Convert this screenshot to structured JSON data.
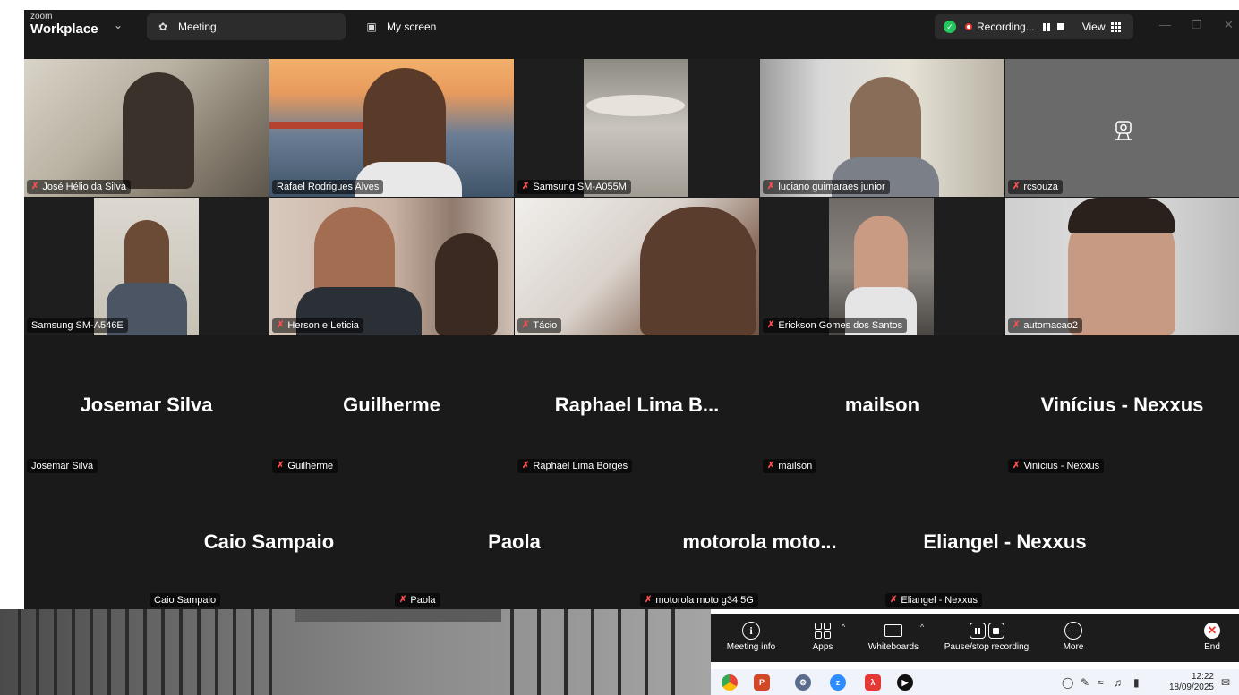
{
  "window": {
    "brand_top": "zoom",
    "brand_bottom": "Workplace",
    "tabs": [
      {
        "label": "Meeting"
      },
      {
        "label": "My screen"
      }
    ],
    "recording_label": "Recording...",
    "view_label": "View"
  },
  "video_tiles": [
    {
      "name": "José Hélio da Silva",
      "muted": true
    },
    {
      "name": "Rafael Rodrigues Alves",
      "muted": false,
      "active": true
    },
    {
      "name": "Samsung SM-A055M",
      "muted": true
    },
    {
      "name": "luciano guimaraes junior",
      "muted": true
    },
    {
      "name": "rcsouza",
      "muted": true,
      "camera_off": true
    },
    {
      "name": "Samsung SM-A546E",
      "muted": false
    },
    {
      "name": "Herson e Leticia",
      "muted": true
    },
    {
      "name": "Tácio",
      "muted": true
    },
    {
      "name": "Erickson Gomes dos Santos",
      "muted": true
    },
    {
      "name": "automacao2",
      "muted": true
    }
  ],
  "name_tiles_row1": [
    {
      "display": "Josemar Silva",
      "tag": "Josemar Silva",
      "muted": false
    },
    {
      "display": "Guilherme",
      "tag": "Guilherme",
      "muted": true
    },
    {
      "display": "Raphael Lima B...",
      "tag": "Raphael Lima Borges",
      "muted": true
    },
    {
      "display": "mailson",
      "tag": "mailson",
      "muted": true
    },
    {
      "display": "Vinícius - Nexxus",
      "tag": "Vinícius - Nexxus",
      "muted": true
    }
  ],
  "name_tiles_row2": [
    {
      "display": "Caio Sampaio",
      "tag": "Caio Sampaio",
      "muted": false
    },
    {
      "display": "Paola",
      "tag": "Paola",
      "muted": true
    },
    {
      "display": "motorola moto...",
      "tag": "motorola moto g34 5G",
      "muted": true
    },
    {
      "display": "Eliangel - Nexxus",
      "tag": "Eliangel - Nexxus",
      "muted": true
    }
  ],
  "controls": {
    "meeting_info": "Meeting info",
    "apps": "Apps",
    "whiteboards": "Whiteboards",
    "pause_stop": "Pause/stop recording",
    "more": "More",
    "end": "End"
  },
  "taskbar": {
    "time": "12:22",
    "date": "18/09/2025"
  },
  "colors": {
    "active_speaker": "#3ddc84",
    "muted": "#ff4d4f",
    "end": "#e53935"
  }
}
